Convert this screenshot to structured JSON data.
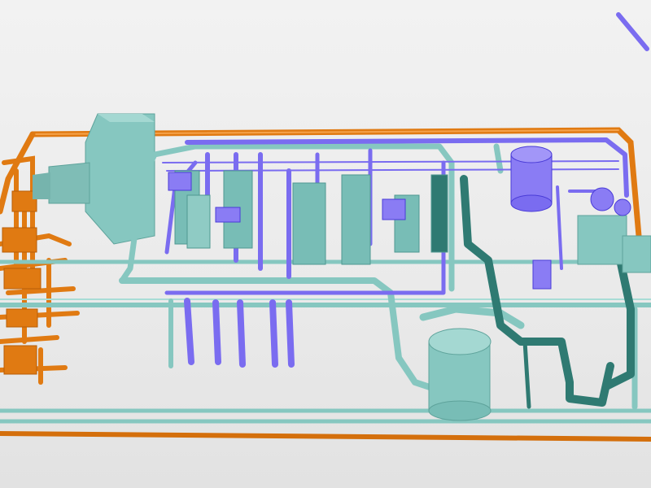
{
  "viewer": {
    "background": "#eaeaea",
    "colors": {
      "frame_orange": "#e07a12",
      "utility_teal": "#86c7c0",
      "utility_teal_dark": "#2f7a72",
      "process_blue": "#7a6cf0",
      "process_blue_dark": "#4a3cd8",
      "equipment_teal": "#78bdb6"
    },
    "icons": [
      "frame-pipe-icon",
      "vessel-icon",
      "pump-skid-icon",
      "cabinet-icon"
    ]
  }
}
